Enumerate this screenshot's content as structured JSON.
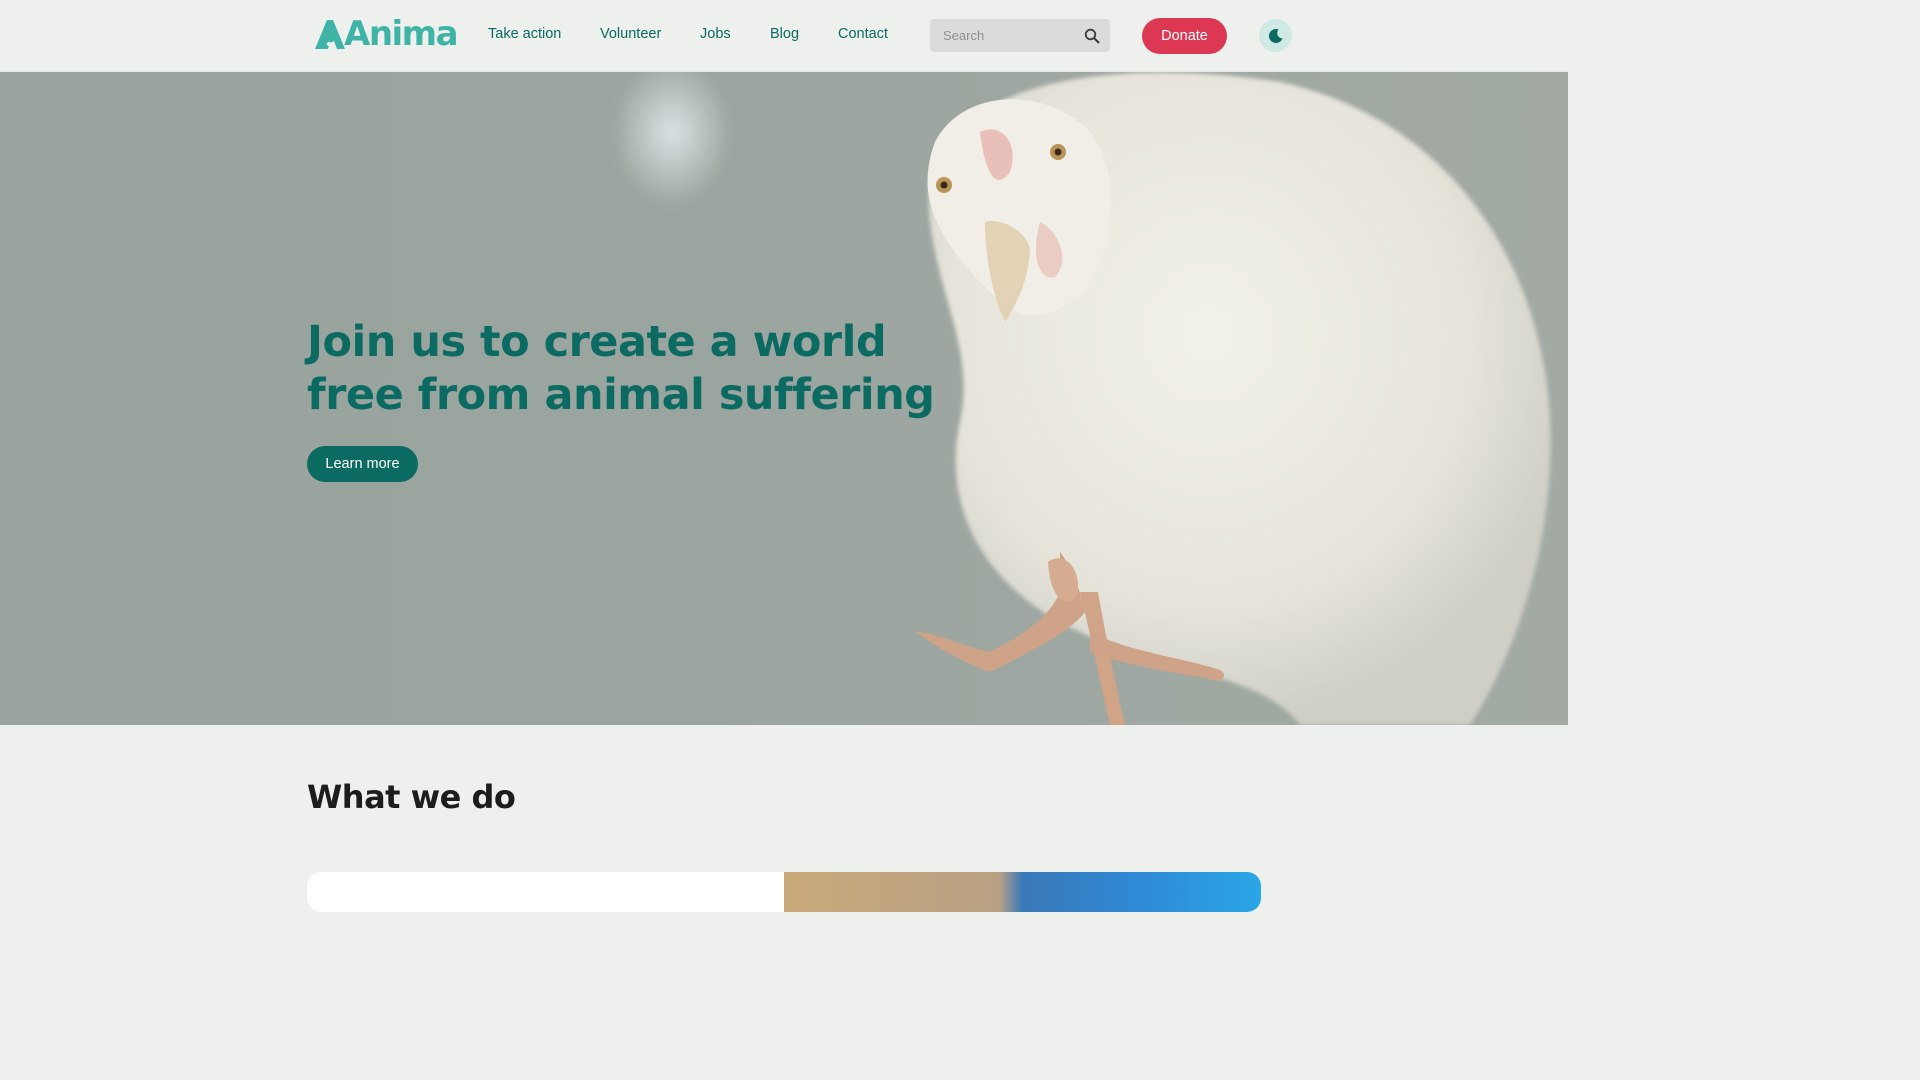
{
  "header": {
    "logo_text": "Anima",
    "nav": [
      {
        "label": "Take action"
      },
      {
        "label": "Volunteer"
      },
      {
        "label": "Jobs"
      },
      {
        "label": "Blog"
      },
      {
        "label": "Contact"
      }
    ],
    "search": {
      "placeholder": "Search",
      "icon": "search-icon"
    },
    "donate_label": "Donate",
    "theme_toggle_icon": "moon-icon"
  },
  "hero": {
    "title": "Join us to create a world free from animal suffering",
    "cta_label": "Learn more",
    "image": "white chicken photo"
  },
  "what_we_do": {
    "title": "What we do"
  },
  "colors": {
    "brand": "#3fb3a6",
    "primary_dark": "#0b6a61",
    "donate": "#dc3854",
    "background": "#eef0ed"
  }
}
